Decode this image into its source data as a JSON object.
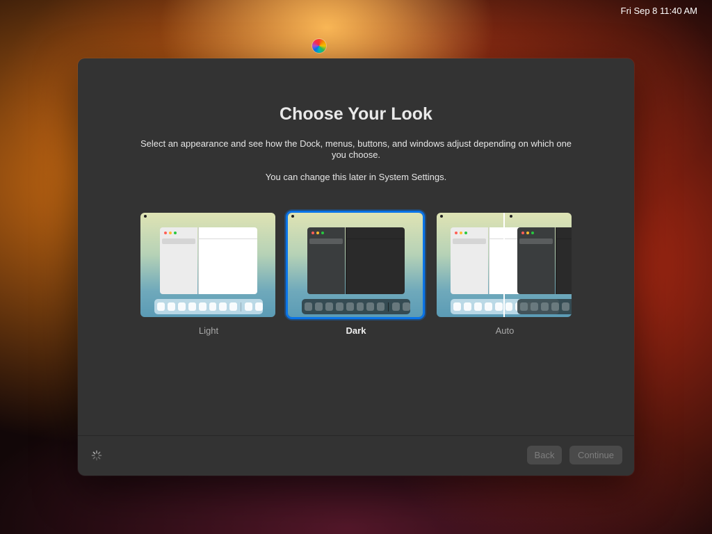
{
  "menubar": {
    "clock": "Fri Sep 8  11:40 AM"
  },
  "icons": {
    "color_wheel": "color-wheel-icon",
    "spinner": "progress-spinner-icon"
  },
  "dialog": {
    "title": "Choose Your Look",
    "description": "Select an appearance and see how the Dock, menus, buttons, and windows adjust depending on which one you choose.",
    "note": "You can change this later in System Settings.",
    "options": [
      {
        "label": "Light",
        "selected": false
      },
      {
        "label": "Dark",
        "selected": true
      },
      {
        "label": "Auto",
        "selected": false
      }
    ],
    "buttons": {
      "back": "Back",
      "continue": "Continue"
    }
  },
  "colors": {
    "accent": "#0a74e8",
    "window_bg": "#333333"
  }
}
